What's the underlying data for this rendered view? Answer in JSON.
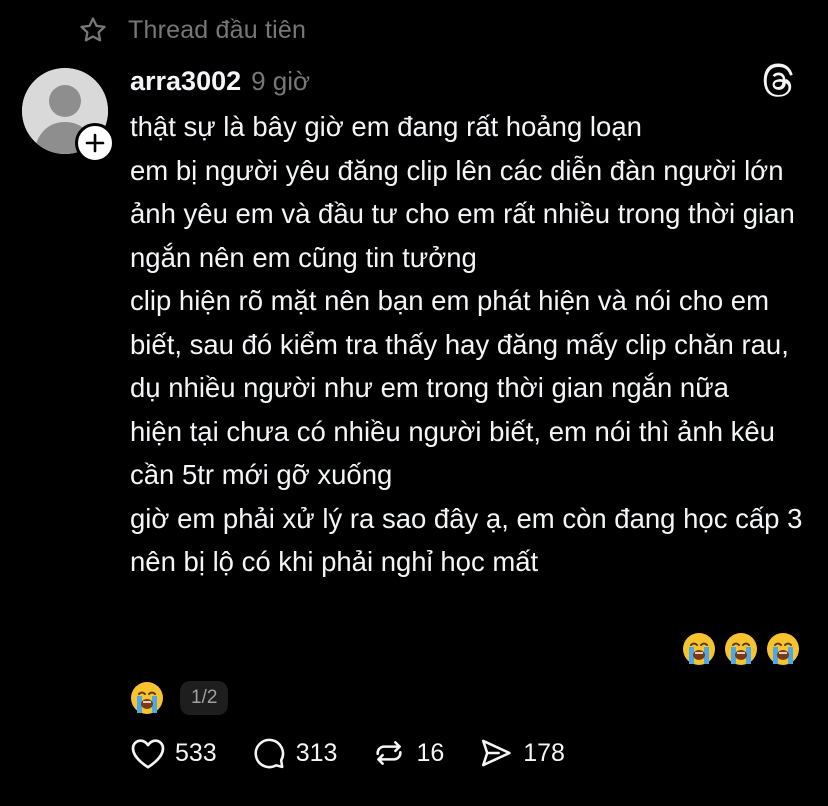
{
  "pinned": {
    "label": "Thread đầu tiên",
    "icon": "star-icon"
  },
  "post": {
    "username": "arra3002",
    "timestamp": "9 giờ",
    "avatar_icon": "default-avatar",
    "follow_icon": "plus-icon",
    "app_icon": "threads-logo-icon",
    "paragraphs": [
      "thật sự là bây giờ em đang rất hoảng loạn",
      "em bị người yêu đăng clip lên các diễn đàn người lớn",
      "ảnh yêu em và đầu tư cho em rất nhiều trong thời gian ngắn nên em cũng tin tưởng",
      "clip hiện rõ mặt nên bạn em phát hiện và nói cho em biết, sau đó kiểm tra thấy hay đăng mấy clip chăn rau, dụ nhiều người như em trong thời gian ngắn nữa",
      "hiện tại chưa có nhiều người biết, em nói thì ảnh kêu cần 5tr mới gỡ xuống",
      "giờ em phải xử lý ra sao đây ạ, em còn đang học cấp 3 nên bị lộ có khi phải nghỉ học mất"
    ],
    "emojis": [
      "loudly-crying-face",
      "loudly-crying-face",
      "loudly-crying-face",
      "loudly-crying-face"
    ],
    "page_indicator": "1/2"
  },
  "actions": {
    "like": {
      "icon": "heart-icon",
      "count": "533"
    },
    "reply": {
      "icon": "comment-icon",
      "count": "313"
    },
    "repost": {
      "icon": "repost-icon",
      "count": "16"
    },
    "share": {
      "icon": "send-icon",
      "count": "178"
    }
  },
  "colors": {
    "background": "#000000",
    "text": "#f3f5f7",
    "muted": "#777777"
  }
}
